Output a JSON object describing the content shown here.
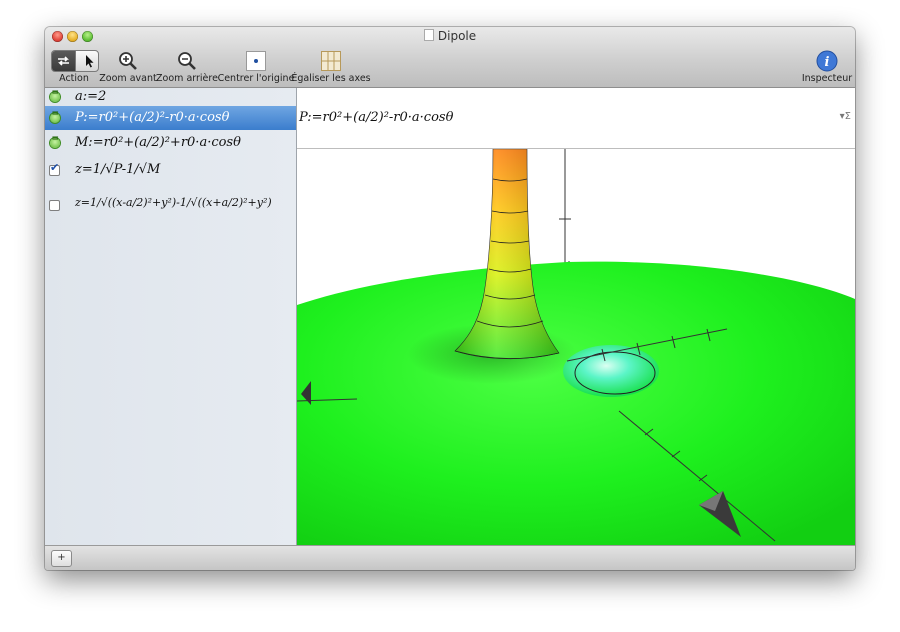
{
  "window": {
    "title": "Dipole"
  },
  "toolbar": {
    "action": "Action",
    "zoom_in": "Zoom avant",
    "zoom_out": "Zoom arrière",
    "center_origin": "Centrer l'origine",
    "equalize_axes": "Égaliser les axes",
    "inspector": "Inspecteur"
  },
  "sidebar": {
    "items": [
      {
        "formula": "a:=2",
        "kind": "definition",
        "selected": false
      },
      {
        "formula": "P:=r0²+(a/2)²-r0·a·cosθ",
        "kind": "definition",
        "selected": true
      },
      {
        "formula": "M:=r0²+(a/2)²+r0·a·cosθ",
        "kind": "definition",
        "selected": false
      },
      {
        "formula": "z=1/√P-1/√M",
        "kind": "surface",
        "checked": true
      },
      {
        "formula": "z=1/√((x-a/2)²+y²)-1/√((x+a/2)²+y²)",
        "kind": "surface",
        "checked": false
      }
    ]
  },
  "formula_bar": {
    "formula": "P:=r0²+(a/2)²-r0·a·cosθ",
    "sigma": "Σ"
  },
  "bottom": {
    "add": "+"
  },
  "colors": {
    "selection": "#3b7dcd",
    "surface_green": "#1ef01e",
    "peak_orange": "#ff8a00",
    "well_cyan": "#5cf5c8"
  }
}
